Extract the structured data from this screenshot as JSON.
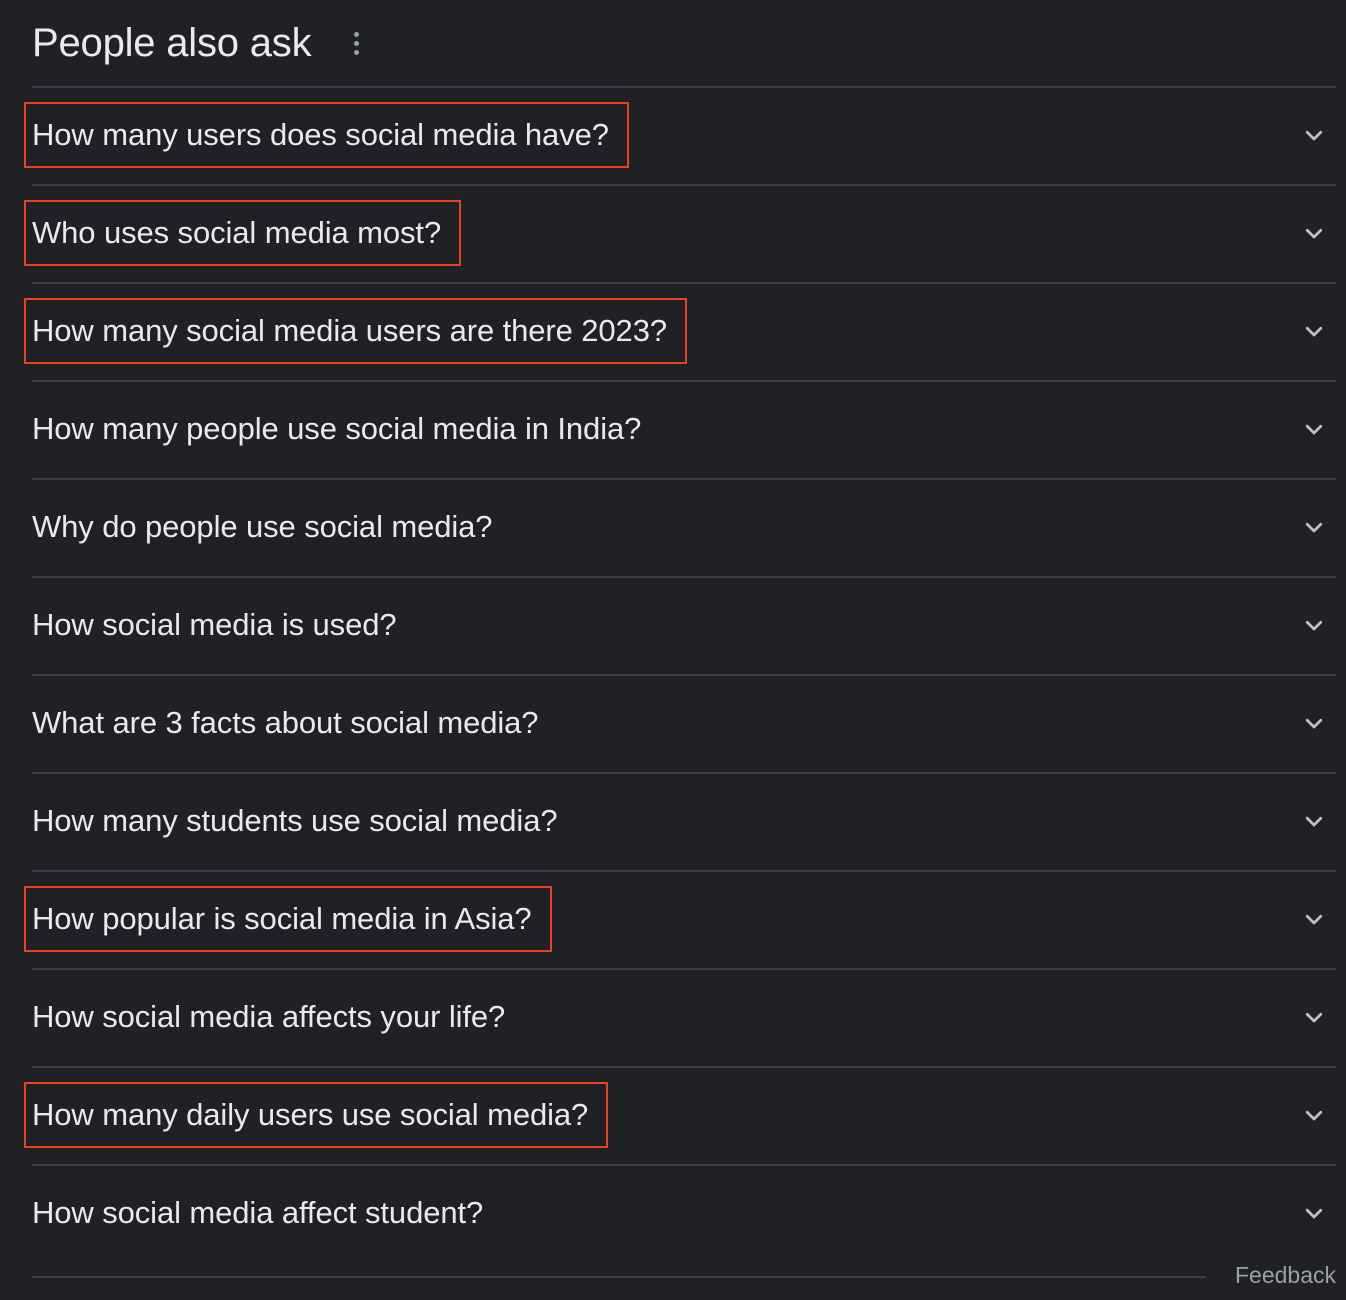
{
  "header": {
    "title": "People also ask",
    "more_icon": "more-vert-icon"
  },
  "questions": [
    {
      "text": "How many users does social media have?",
      "highlighted": true
    },
    {
      "text": "Who uses social media most?",
      "highlighted": true
    },
    {
      "text": "How many social media users are there 2023?",
      "highlighted": true
    },
    {
      "text": "How many people use social media in India?",
      "highlighted": false
    },
    {
      "text": "Why do people use social media?",
      "highlighted": false
    },
    {
      "text": "How social media is used?",
      "highlighted": false
    },
    {
      "text": "What are 3 facts about social media?",
      "highlighted": false
    },
    {
      "text": "How many students use social media?",
      "highlighted": false
    },
    {
      "text": "How popular is social media in Asia?",
      "highlighted": true
    },
    {
      "text": "How social media affects your life?",
      "highlighted": false
    },
    {
      "text": "How many daily users use social media?",
      "highlighted": true
    },
    {
      "text": "How social media affect student?",
      "highlighted": false
    }
  ],
  "item_icon": "chevron-down-icon",
  "footer": {
    "feedback_label": "Feedback"
  },
  "colors": {
    "background": "#202124",
    "text": "#e8eaed",
    "divider": "#3c4043",
    "muted": "#9aa0a6",
    "highlight_box": "#e8431f"
  }
}
